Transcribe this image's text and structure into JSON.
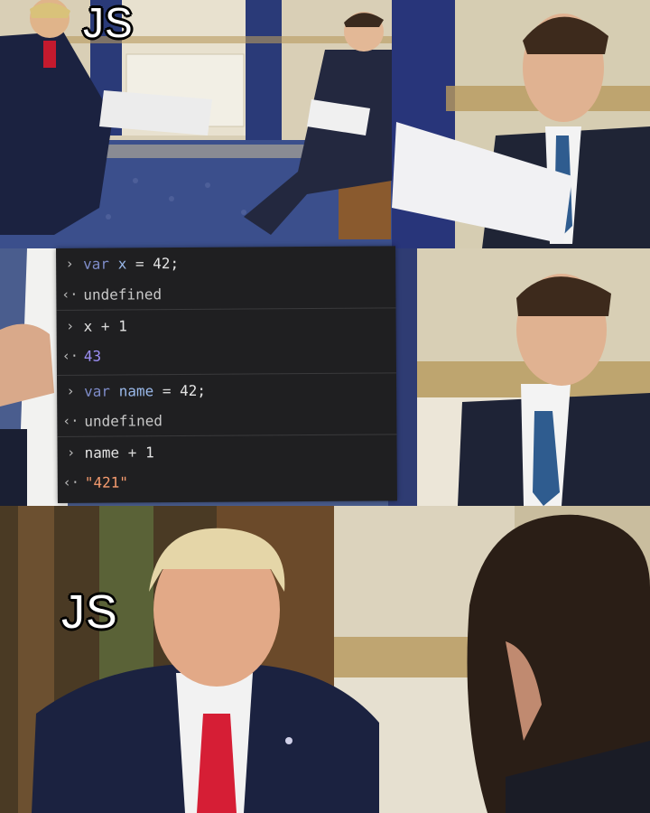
{
  "captions": {
    "top_label": "JS",
    "bottom_label": "JS"
  },
  "console": {
    "entries": [
      {
        "type": "input",
        "keyword": "var",
        "name": "x",
        "op": "=",
        "value": "42;"
      },
      {
        "type": "output",
        "text": "undefined"
      },
      {
        "type": "input",
        "name": "x",
        "op": "+",
        "value": "1"
      },
      {
        "type": "output",
        "text": "43"
      },
      {
        "type": "input",
        "keyword": "var",
        "name": "name",
        "op": "=",
        "value": "42;"
      },
      {
        "type": "output",
        "text": "undefined"
      },
      {
        "type": "input",
        "name": "name",
        "op": "+",
        "value": "1"
      },
      {
        "type": "output",
        "text": "\"421\""
      }
    ],
    "input_glyph": "›",
    "output_glyph": "‹·"
  },
  "colors": {
    "console_bg": "#1f1f21",
    "string_output": "#f39a6e",
    "number_output": "#9c8ff5"
  }
}
